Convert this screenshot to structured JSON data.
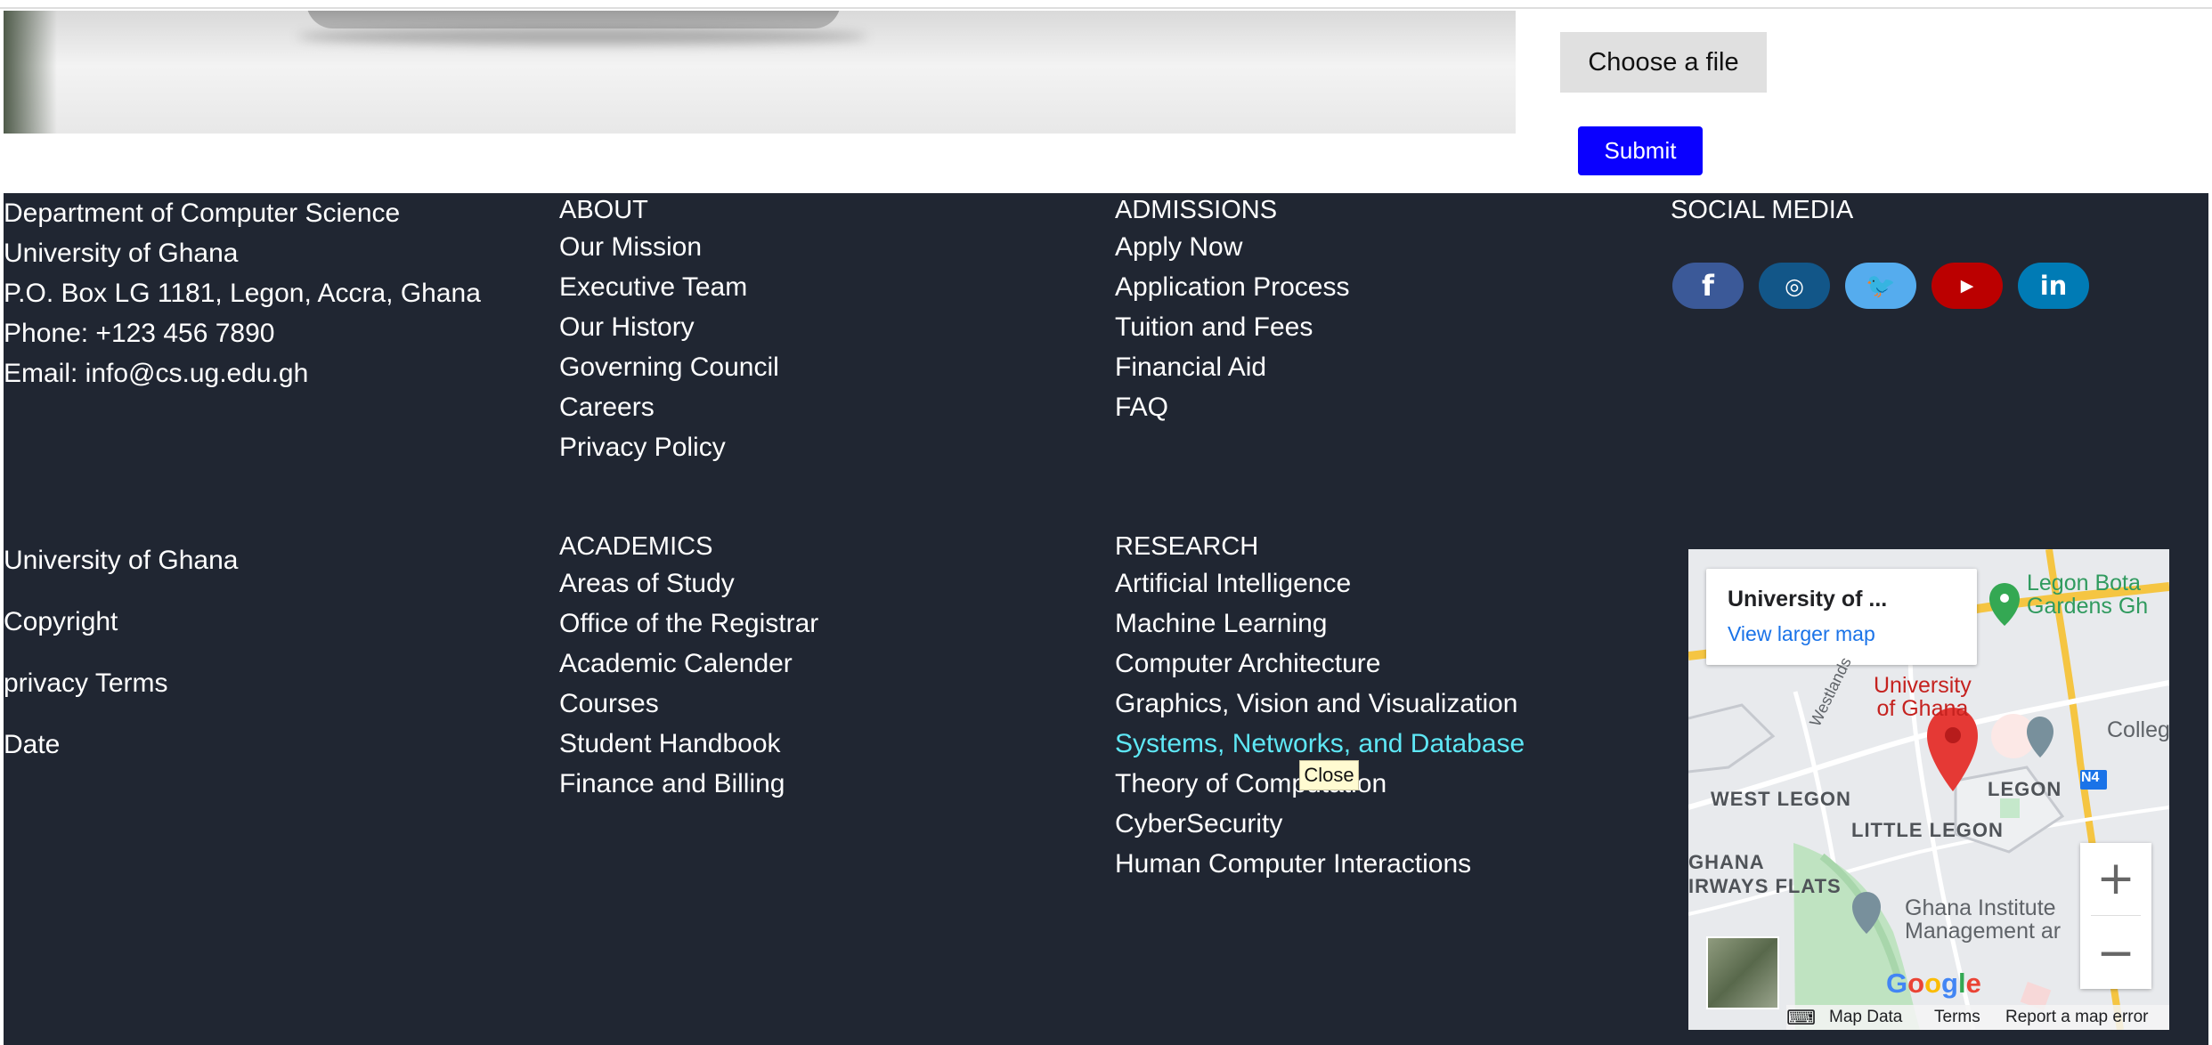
{
  "top": {
    "file_button": "Choose a file",
    "submit_button": "Submit"
  },
  "footer": {
    "address": [
      "Department of Computer Science",
      "University of Ghana",
      "P.O. Box LG 1181, Legon, Accra, Ghana",
      "Phone: +123 456 7890",
      "Email: info@cs.ug.edu.gh"
    ],
    "about": {
      "title": "ABOUT",
      "items": [
        "Our Mission",
        "Executive Team",
        "Our History",
        "Governing Council",
        "Careers",
        "Privacy Policy"
      ]
    },
    "admissions": {
      "title": "ADMISSIONS",
      "items": [
        "Apply Now",
        "Application Process",
        "Tuition and Fees",
        "Financial Aid",
        "FAQ"
      ]
    },
    "social": {
      "title": "SOCIAL MEDIA",
      "icons": [
        "facebook-icon",
        "instagram-icon",
        "twitter-icon",
        "youtube-icon",
        "linkedin-icon"
      ]
    },
    "legal": [
      "University of Ghana",
      "Copyright",
      "privacy Terms",
      "Date"
    ],
    "academics": {
      "title": "ACADEMICS",
      "items": [
        "Areas of Study",
        "Office of the Registrar",
        "Academic Calender",
        "Courses",
        "Student Handbook",
        "Finance and Billing"
      ]
    },
    "research": {
      "title": "RESEARCH",
      "items": [
        "Artificial Intelligence",
        "Machine Learning",
        "Computer Architecture",
        "Graphics, Vision and Visualization",
        "Systems, Networks, and Database",
        "Theory of Computation",
        "CyberSecurity",
        "Human Computer Interactions"
      ],
      "hovered_index": 4
    },
    "tooltip": "Close"
  },
  "map": {
    "card_title": "University of ...",
    "card_link": "View larger map",
    "labels": {
      "westlands": "Westlands",
      "west_legon": "WEST LEGON",
      "legon": "LEGON",
      "little_legon": "LITTLE LEGON",
      "ghana": "GHANA",
      "airways_flats": "IRWAYS FLATS",
      "n4": "N4",
      "legon_gardens_1": "Legon Bota",
      "legon_gardens_2": "Gardens Gh",
      "university_1": "University",
      "university_2": "of Ghana",
      "college": "Colleg",
      "gimpa_1": "Ghana Institute",
      "gimpa_2": "Management ar"
    },
    "google": "Google",
    "footer": {
      "keyboard": "⌨",
      "map_data": "Map Data",
      "terms": "Terms",
      "report": "Report a map error"
    },
    "zoom_in": "+",
    "zoom_out": "−"
  },
  "colors": {
    "footer_bg": "#202632",
    "highlight": "#5ee7f5",
    "submit": "#0a00ff",
    "facebook": "#3b5998",
    "instagram": "#125688",
    "twitter": "#55acee",
    "youtube": "#bb0000",
    "linkedin": "#007bb5"
  }
}
